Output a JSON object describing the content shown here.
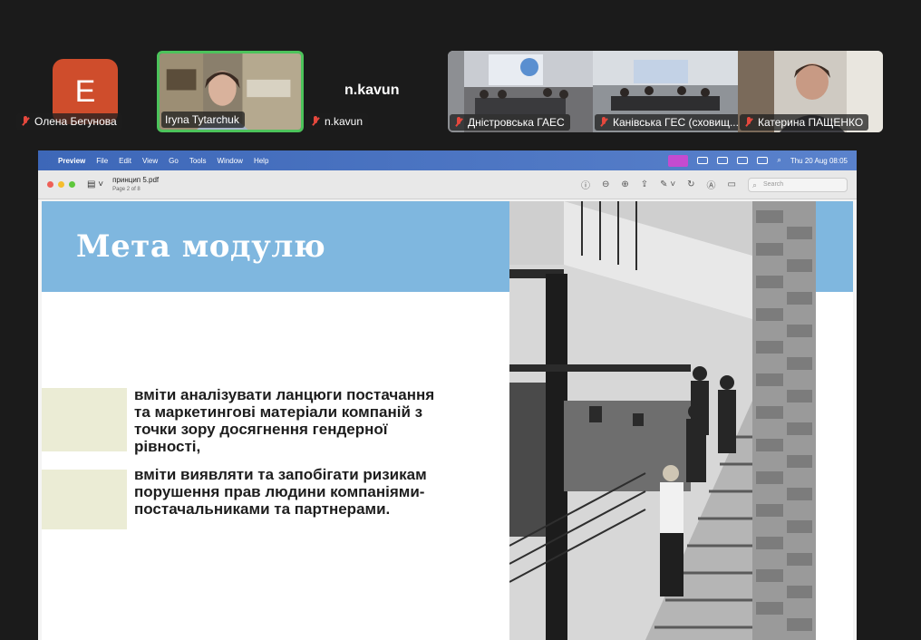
{
  "participants": [
    {
      "initial": "E",
      "name": "Олена Бегунова"
    },
    {
      "name": "Iryna Tytarchuk"
    },
    {
      "name": "n.kavun",
      "display": "n.kavun"
    },
    {
      "name": "Дністровська ГАЕС"
    },
    {
      "name": "Канівська ГЕС (сховищ..."
    },
    {
      "name": "Катерина ПАЩЕНКО"
    }
  ],
  "mac_menu": {
    "app": "Preview",
    "items": [
      "File",
      "Edit",
      "View",
      "Go",
      "Tools",
      "Window",
      "Help"
    ],
    "clock": "Thu 20 Aug  08:05"
  },
  "preview_toolbar": {
    "file_name": "принцип 5.pdf",
    "page_info": "Page 2 of 8",
    "search_placeholder": "Search"
  },
  "slide": {
    "title": "Мета модулю",
    "bullets": [
      "вміти аналізувати ланцюги постачання та маркетингові матеріали компаній з точки зору досягнення гендерної рівності,",
      "вміти виявляти та запобігати ризикам порушення прав людини компаніями-постачальниками та партнерами."
    ]
  },
  "colors": {
    "band": "#7fb7df",
    "block": "#ebecd5",
    "avatar": "#cf4d2c",
    "active_speaker_border": "#4cc35b",
    "muted_mic": "#e5483d"
  }
}
